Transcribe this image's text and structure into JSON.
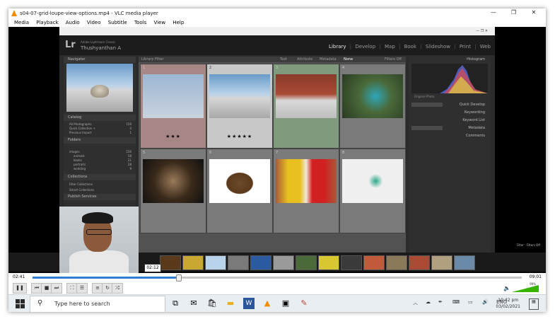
{
  "window": {
    "title": "s04-07-grid-loupe-view-options.mp4 - VLC media player",
    "controls": [
      "—",
      "❐",
      "✕"
    ]
  },
  "menu": [
    "Media",
    "Playback",
    "Audio",
    "Video",
    "Subtitle",
    "Tools",
    "View",
    "Help"
  ],
  "lightroom": {
    "app_line": "Adobe Lightroom Classic",
    "user": "Thushyanthan A",
    "modules": [
      "Library",
      "Develop",
      "Map",
      "Book",
      "Slideshow",
      "Print",
      "Web"
    ],
    "active_module": "Library",
    "left_panel": {
      "navigator": "Navigator",
      "catalog": "Catalog",
      "catalog_items": [
        {
          "label": "All Photographs",
          "count": "156"
        },
        {
          "label": "Quick Collection +",
          "count": "0"
        },
        {
          "label": "Previous Import",
          "count": "1"
        }
      ],
      "folders": "Folders",
      "folder_items": [
        {
          "label": "images",
          "count": "156"
        },
        {
          "label": "animals",
          "count": "58"
        },
        {
          "label": "books",
          "count": "21"
        },
        {
          "label": "portraits",
          "count": "28"
        },
        {
          "label": "wedding",
          "count": "9"
        }
      ],
      "collections": "Collections",
      "collection_items": [
        {
          "label": "Filter Collections"
        },
        {
          "label": "Smart Collections"
        }
      ],
      "publish": "Publish Services"
    },
    "library_filter": {
      "label": "Library Filter",
      "tabs": [
        "Text",
        "Attribute",
        "Metadata",
        "None"
      ],
      "filters_off": "Filters Off"
    },
    "grid": [
      {
        "num": "1",
        "stars": "★★★"
      },
      {
        "num": "2",
        "stars": "★★★★★"
      },
      {
        "num": "3",
        "stars": ""
      },
      {
        "num": "4",
        "stars": ""
      },
      {
        "num": "5",
        "stars": ""
      },
      {
        "num": "6",
        "stars": ""
      },
      {
        "num": "7",
        "stars": ""
      },
      {
        "num": "8",
        "stars": ""
      }
    ],
    "right_panel": {
      "histogram": "Histogram",
      "original_photo": "Original Photo",
      "rows": [
        "Quick Develop",
        "Keywording",
        "Keyword List",
        "Metadata",
        "Comments"
      ]
    },
    "toolbar_sort": "Capture Time",
    "filmstrip_info": "1 selected",
    "filter_label": "Filter :",
    "filter_value": "Filters Off"
  },
  "overlay_time": "02:12",
  "player": {
    "current": "02:41",
    "duration": "09:01",
    "progress": 0.297,
    "volume": "99%",
    "volume_level": 0.99
  },
  "taskbar": {
    "search_placeholder": "Type here to search",
    "lang": "ENG",
    "time": "10:42 pm",
    "date": "03/02/2021"
  },
  "colors": {
    "vlc_orange": "#f28c00",
    "seek_blue": "#2f7fd2",
    "volume_green": "#37b400"
  }
}
